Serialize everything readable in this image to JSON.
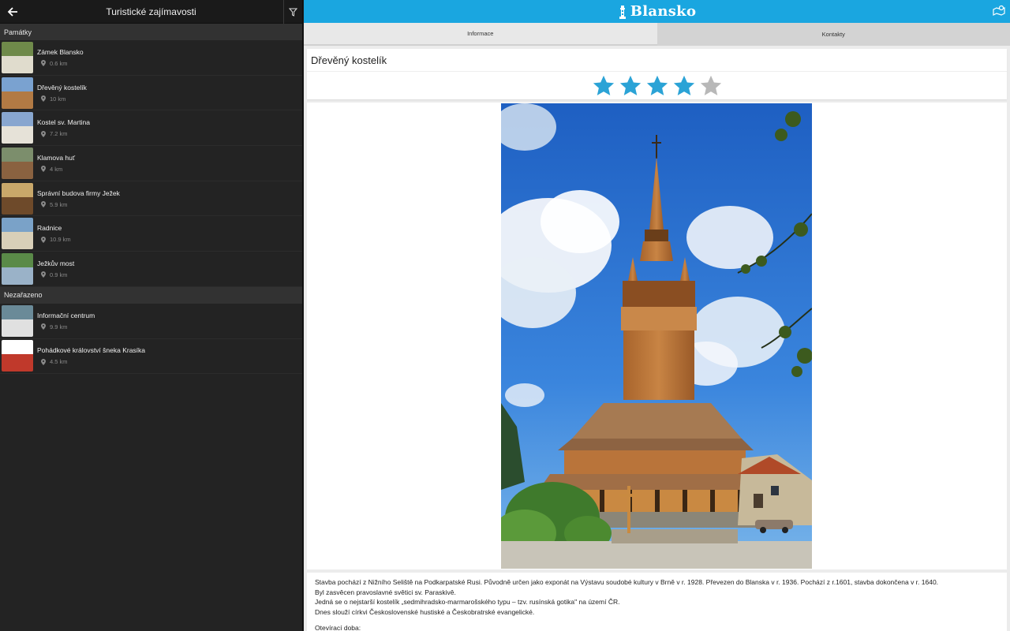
{
  "left_header": {
    "title": "Turistické zajímavosti",
    "back_icon": "back-arrow-icon",
    "filter_icon": "filter-icon"
  },
  "sections": [
    {
      "title": "Památky",
      "items": [
        {
          "name": "Zámek Blansko",
          "distance": "0.6 km"
        },
        {
          "name": "Dřevěný kostelík",
          "distance": "10 km"
        },
        {
          "name": "Kostel sv. Martina",
          "distance": "7.2 km"
        },
        {
          "name": "Klamova huť",
          "distance": "4 km"
        },
        {
          "name": "Správní budova firmy Ježek",
          "distance": "5.9 km"
        },
        {
          "name": "Radnice",
          "distance": "10.9 km"
        },
        {
          "name": "Ježkův most",
          "distance": "0.9 km"
        }
      ]
    },
    {
      "title": "Nezařazeno",
      "items": [
        {
          "name": "Informační centrum",
          "distance": "9.9 km"
        },
        {
          "name": "Pohádkové království šneka Krasíka",
          "distance": "4.5 km"
        }
      ]
    }
  ],
  "top_bar": {
    "brand": "Blansko",
    "accent": "#1aa6e0",
    "map_icon": "map-icon"
  },
  "tabs": [
    {
      "label": "Informace",
      "active": true
    },
    {
      "label": "Kontakty",
      "active": false
    }
  ],
  "detail": {
    "title": "Dřevěný kostelík",
    "rating": 4,
    "rating_max": 5,
    "star_color": "#2ba3d6",
    "description": [
      "Stavba pochází z Nižního Seliště na Podkarpatské Rusi. Původně určen jako exponát na Výstavu soudobé kultury v Brně v r. 1928. Převezen do Blanska v r. 1936. Pochází z r.1601, stavba dokončena v r. 1640.",
      "Byl zasvěcen pravoslavné světici sv. Paraskivě.",
      "Jedná se o nejstarší kostelík „sedmihradsko-marmarošského typu – tzv. rusínská gotika\" na území ČR.",
      "Dnes slouží církvi Československé hustiské a Českobratrské evangelické.",
      "Otevírací doba:"
    ]
  }
}
